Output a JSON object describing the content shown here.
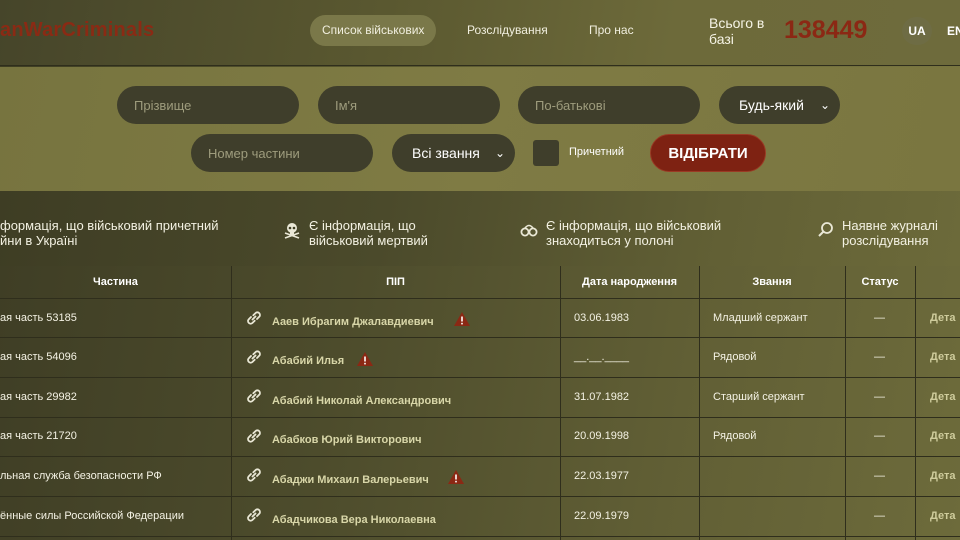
{
  "header": {
    "logo": "anWarCriminals",
    "nav": [
      "Список військових",
      "Розслідування",
      "Про нас"
    ],
    "total_label": "Всього в базі",
    "total_count": "138449",
    "languages": [
      "UA",
      "EN"
    ]
  },
  "filters": {
    "surname_placeholder": "Прізвище",
    "name_placeholder": "Ім'я",
    "patronymic_placeholder": "По-батькові",
    "any_select": "Будь-який",
    "unit_placeholder": "Номер частини",
    "ranks_select": "Всі звання",
    "involved_label": "Причетний",
    "submit": "ВІДІБРАТИ"
  },
  "legend": {
    "involved": "формація, що військовий причетний\nйни в Україні",
    "dead": "Є інформація, що\nвійськовий мертвий",
    "captive": "Є інформація, що військовий\nзнаходиться у полоні",
    "journalism": "Наявне журналі\nрозслідування"
  },
  "table": {
    "headers": [
      "Частина",
      "ПІП",
      "Дата народження",
      "Звання",
      "Статус"
    ],
    "detail_label": "Дета",
    "rows": [
      {
        "unit": "ая часть 53185",
        "name": "Аaев Ибрагим Джалавдиевич",
        "dob": "03.06.1983",
        "rank": "Младший сержант",
        "status": "—",
        "warn": true
      },
      {
        "unit": "ая часть 54096",
        "name": "Абабий Илья",
        "dob": "__.__.____",
        "rank": "Рядовой",
        "status": "—",
        "warn": true
      },
      {
        "unit": "ая часть 29982",
        "name": "Абабий Николай Александрович",
        "dob": "31.07.1982",
        "rank": "Старший сержант",
        "status": "—",
        "warn": false
      },
      {
        "unit": "ая часть 21720",
        "name": "Абабков Юрий Викторович",
        "dob": "20.09.1998",
        "rank": "Рядовой",
        "status": "—",
        "warn": false
      },
      {
        "unit": "льная служба безопасности РФ",
        "name": "Абаджи Михаил Валерьевич",
        "dob": "22.03.1977",
        "rank": "",
        "status": "—",
        "warn": true
      },
      {
        "unit": "ённые силы Российской Федерации",
        "name": "Абадчикова Вера Николаевна",
        "dob": "22.09.1979",
        "rank": "",
        "status": "—",
        "warn": false
      }
    ]
  },
  "colors": {
    "accent_red": "#8b2814",
    "button_red": "#7e2212",
    "warning": "#8b2814"
  }
}
